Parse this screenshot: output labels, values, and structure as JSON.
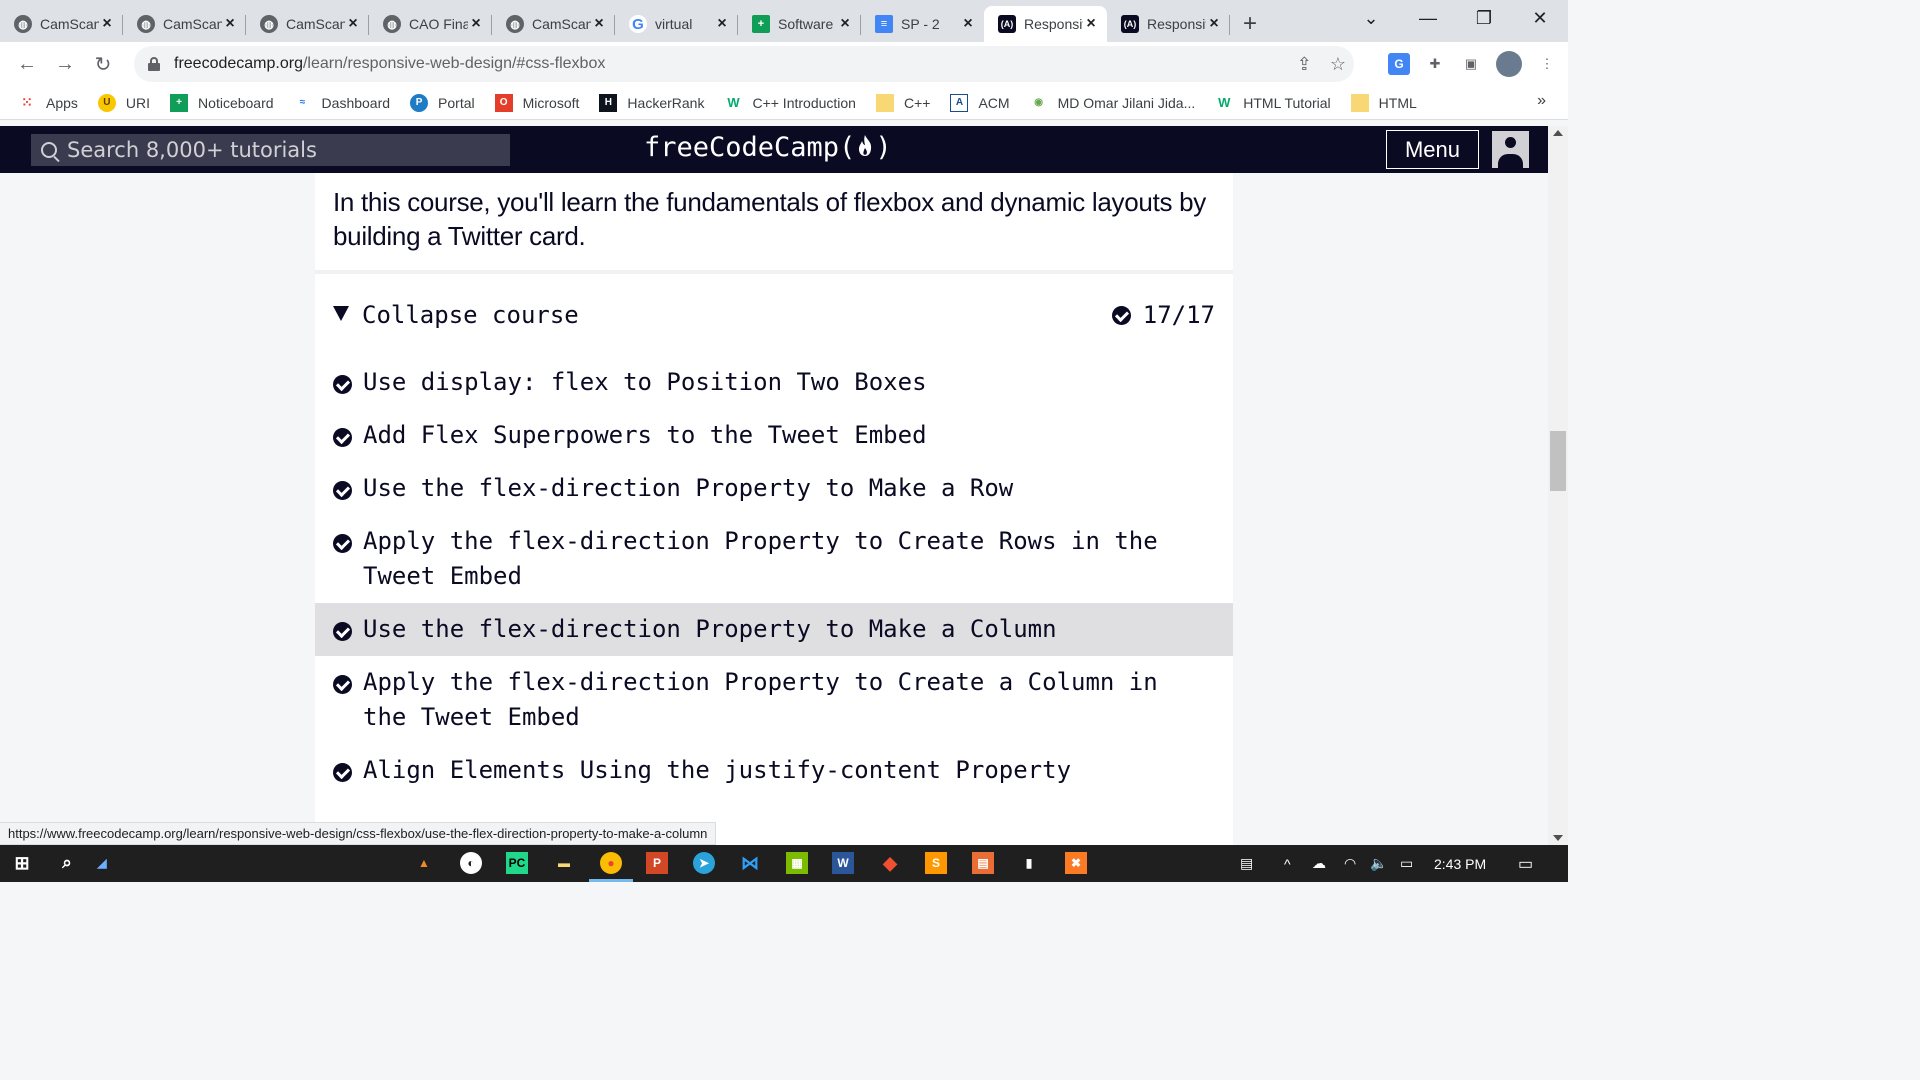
{
  "browser": {
    "tabs": [
      {
        "title": "CamScanner",
        "favicon": "globe-icon"
      },
      {
        "title": "CamScanner",
        "favicon": "globe-icon"
      },
      {
        "title": "CamScanner",
        "favicon": "globe-icon"
      },
      {
        "title": "CAO Final",
        "favicon": "globe-icon"
      },
      {
        "title": "CamScanner",
        "favicon": "globe-icon"
      },
      {
        "title": "virtual",
        "favicon": "google-icon"
      },
      {
        "title": "Software",
        "favicon": "sheets-icon"
      },
      {
        "title": "SP - 2",
        "favicon": "docs-icon"
      },
      {
        "title": "Responsive",
        "favicon": "freecodecamp-icon",
        "active": true
      },
      {
        "title": "Responsive",
        "favicon": "freecodecamp-icon"
      }
    ],
    "url_host": "freecodecamp.org",
    "url_path": "/learn/responsive-web-design/#css-flexbox",
    "bookmarks": [
      {
        "label": "Apps",
        "icon": "apps-grid-icon"
      },
      {
        "label": "URI",
        "icon": "uri-icon"
      },
      {
        "label": "Noticeboard",
        "icon": "plus-green-icon"
      },
      {
        "label": "Dashboard",
        "icon": "dashboard-icon"
      },
      {
        "label": "Portal",
        "icon": "portal-icon"
      },
      {
        "label": "Microsoft",
        "icon": "office-icon"
      },
      {
        "label": "HackerRank",
        "icon": "hackerrank-icon"
      },
      {
        "label": "C++ Introduction",
        "icon": "w3schools-icon"
      },
      {
        "label": "C++",
        "icon": "folder-icon"
      },
      {
        "label": "ACM",
        "icon": "acm-icon"
      },
      {
        "label": "MD Omar Jilani Jida...",
        "icon": "profile-icon"
      },
      {
        "label": "HTML Tutorial",
        "icon": "w3schools-icon"
      },
      {
        "label": "HTML",
        "icon": "folder-icon"
      }
    ],
    "bookmarks_more": "»",
    "status_url": "https://www.freecodecamp.org/learn/responsive-web-design/css-flexbox/use-the-flex-direction-property-to-make-a-column"
  },
  "fcc": {
    "search_placeholder": "Search 8,000+ tutorials",
    "logo": "freeCodeCamp(🔥)",
    "logo_text": "freeCodeCamp",
    "menu_label": "Menu"
  },
  "course": {
    "intro": "In this course, you'll learn the fundamentals of flexbox and dynamic layouts by building a Twitter card.",
    "collapse_label": "Collapse course",
    "progress": "17/17",
    "lessons": [
      {
        "title": "Use display: flex to Position Two Boxes",
        "completed": true
      },
      {
        "title": "Add Flex Superpowers to the Tweet Embed",
        "completed": true
      },
      {
        "title": "Use the flex-direction Property to Make a Row",
        "completed": true
      },
      {
        "title": "Apply the flex-direction Property to Create Rows in the Tweet Embed",
        "completed": true
      },
      {
        "title": "Use the flex-direction Property to Make a Column",
        "completed": true,
        "highlighted": true
      },
      {
        "title": "Apply the flex-direction Property to Create a Column in the Tweet Embed",
        "completed": true
      },
      {
        "title": "Align Elements Using the justify-content Property",
        "completed": true
      }
    ]
  },
  "taskbar": {
    "clock": "2:43 PM"
  },
  "colors": {
    "fcc_dark": "#0a0a23",
    "fcc_search_bg": "#3b3b4f",
    "highlight_row": "#dfdfe2",
    "page_bg": "#f5f6f7"
  }
}
